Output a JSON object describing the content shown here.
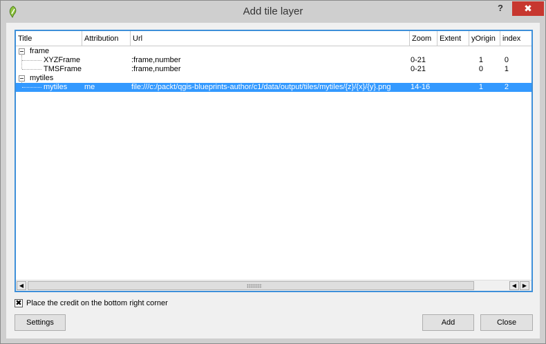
{
  "window": {
    "title": "Add tile layer",
    "help_label": "?",
    "close_label": "✖"
  },
  "table": {
    "headers": [
      "Title",
      "Attribution",
      "Url",
      "Zoom",
      "Extent",
      "yOrigin",
      "index"
    ],
    "rows": [
      {
        "title": "frame",
        "attribution": "",
        "url": "",
        "zoom": "",
        "extent": "",
        "yorigin": "",
        "index": ""
      },
      {
        "title": "XYZFrame",
        "attribution": "",
        "url": ":frame,number",
        "zoom": "0-21",
        "extent": "",
        "yorigin": "1",
        "index": "0"
      },
      {
        "title": "TMSFrame",
        "attribution": "",
        "url": ":frame,number",
        "zoom": "0-21",
        "extent": "",
        "yorigin": "0",
        "index": "1"
      },
      {
        "title": "mytiles",
        "attribution": "",
        "url": "",
        "zoom": "",
        "extent": "",
        "yorigin": "",
        "index": ""
      },
      {
        "title": "mytiles",
        "attribution": "me",
        "url": "file:///c:/packt/qgis-blueprints-author/c1/data/output/tiles/mytiles/{z}/{x}/{y}.png",
        "zoom": "14-16",
        "extent": "",
        "yorigin": "1",
        "index": "2"
      }
    ]
  },
  "scrollbar": {
    "left_arrow": "◀",
    "right_arrow": "▶"
  },
  "options": {
    "credit_label": "Place the credit on the bottom right corner",
    "credit_mark": "✖"
  },
  "buttons": {
    "settings": "Settings",
    "add": "Add",
    "close": "Close"
  },
  "colors": {
    "selection": "#3399ff",
    "focus_border": "#3d8fd9",
    "close_button": "#c7372f"
  }
}
